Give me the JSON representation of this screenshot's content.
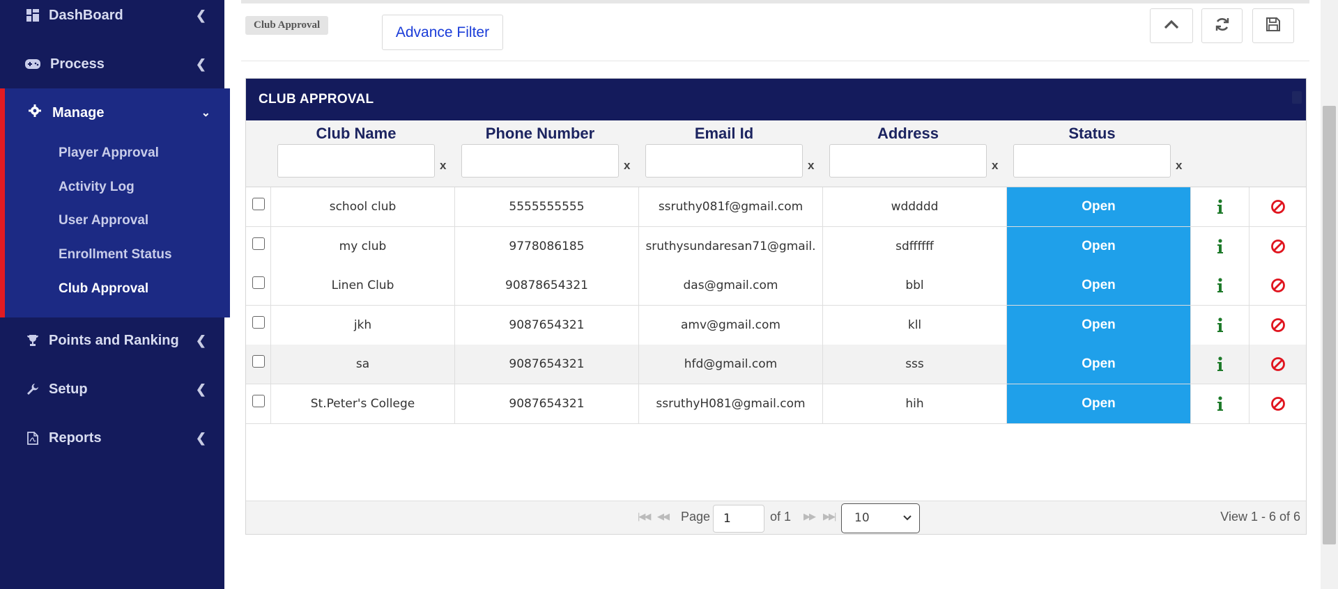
{
  "sidebar": {
    "items": [
      {
        "label": "DashBoard",
        "icon": "dashboard-icon"
      },
      {
        "label": "Process",
        "icon": "gamepad-icon"
      },
      {
        "label": "Manage",
        "icon": "gear-icon"
      },
      {
        "label": "Points and Ranking",
        "icon": "trophy-icon"
      },
      {
        "label": "Setup",
        "icon": "wrench-icon"
      },
      {
        "label": "Reports",
        "icon": "pdf-file-icon"
      }
    ],
    "manage_subitems": [
      {
        "label": "Player Approval"
      },
      {
        "label": "Activity Log"
      },
      {
        "label": "User Approval"
      },
      {
        "label": "Enrollment Status"
      },
      {
        "label": "Club Approval",
        "active": true
      }
    ]
  },
  "header": {
    "breadcrumb": "Club Approval",
    "advance_filter_label": "Advance Filter",
    "tools": [
      "chevron-up-icon",
      "refresh-icon",
      "save-icon"
    ]
  },
  "grid": {
    "caption": "CLUB APPROVAL",
    "columns": [
      "Club Name",
      "Phone Number",
      "Email Id",
      "Address",
      "Status"
    ],
    "filter_clear": "x",
    "rows": [
      {
        "club": "school club",
        "phone": "5555555555",
        "email": "ssruthy081f@gmail.com",
        "address": "wddddd",
        "status": "Open"
      },
      {
        "club": "my club",
        "phone": "9778086185",
        "email": "sruthysundaresan71@gmail.",
        "address": "sdffffff",
        "status": "Open"
      },
      {
        "club": "Linen Club",
        "phone": "90878654321",
        "email": "das@gmail.com",
        "address": "bbl",
        "status": "Open"
      },
      {
        "club": "jkh",
        "phone": "9087654321",
        "email": "amv@gmail.com",
        "address": "kll",
        "status": "Open"
      },
      {
        "club": "sa",
        "phone": "9087654321",
        "email": "hfd@gmail.com",
        "address": "sss",
        "status": "Open"
      },
      {
        "club": "St.Peter's College",
        "phone": "9087654321",
        "email": "ssruthyH081@gmail.com",
        "address": "hih",
        "status": "Open"
      }
    ]
  },
  "pager": {
    "page_label": "Page",
    "page_value": "1",
    "of_label": "of 1",
    "rows_per_page": "10",
    "view_info": "View 1 - 6 of 6"
  },
  "colors": {
    "sidebar_bg": "#141b5c",
    "manage_bg": "#1c2a84",
    "active_marker": "#e11b22",
    "status_bg": "#1fa0ea",
    "info_icon": "#1e7a2a",
    "block_icon": "#e0141e"
  }
}
